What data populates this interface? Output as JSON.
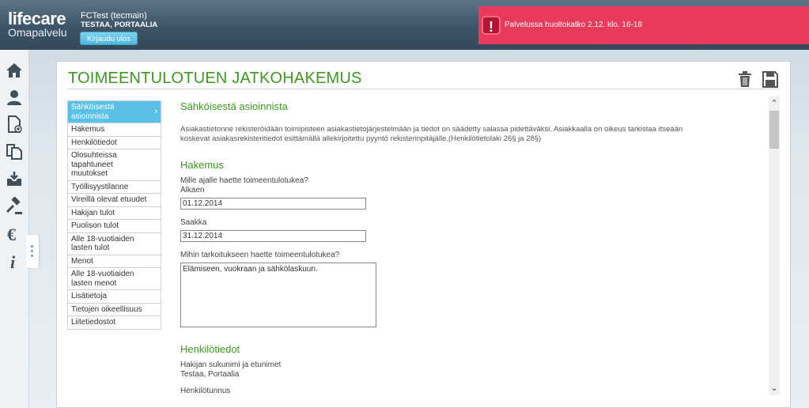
{
  "header": {
    "brand": "lifecare",
    "product": "Omapalvelu",
    "user_name": "FCTest (tecmain)",
    "user_client": "TESTAA, PORTAALIA",
    "logout_label": "Kirjaudu ulos",
    "alert_icon": "!",
    "alert_text": "Palvelussa huoltokatko 2.12. klo. 16-18"
  },
  "sidebar": {
    "icons": [
      "home-icon",
      "person-icon",
      "new-document-icon",
      "documents-icon",
      "inbox-icon",
      "gavel-icon",
      "euro-icon",
      "info-icon"
    ]
  },
  "page": {
    "title": "TOIMEENTULOTUEN JATKOHAKEMUS"
  },
  "nav": {
    "items": [
      {
        "label": "Sähköisestä asioinnista"
      },
      {
        "label": "Hakemus"
      },
      {
        "label": "Henkilötiedot"
      },
      {
        "label": "Olosuhteissa tapahtuneet muutokset"
      },
      {
        "label": "Työllisyystilanne"
      },
      {
        "label": "Vireillä olevat etuudet"
      },
      {
        "label": "Hakijan tulot"
      },
      {
        "label": "Puolison tulot"
      },
      {
        "label": "Alle 18-vuotiaiden lasten tulot"
      },
      {
        "label": "Menot"
      },
      {
        "label": "Alle 18-vuotiaiden lasten menot"
      },
      {
        "label": "Lisätietoja"
      },
      {
        "label": "Tietojen oikeellisuus"
      },
      {
        "label": "Liitetiedostot"
      }
    ]
  },
  "content": {
    "section1_title": "Sähköisestä asioinnista",
    "section1_text": "Asiakastietonne rekisteröidään toimipisteen asiakastietojärjestelmään ja tiedot on säädetty salassa pidettäväksi. Asiakkaalla on oikeus tarkistaa itseään koskevat asiakasrekisteritiedot esittämällä allekirjoitettu pyyntö rekisterinpitäjälle.(Henkilötietolaki 26§ ja 28§)",
    "section2_title": "Hakemus",
    "question_period": "Mille ajalle haette toimeentulotukea?",
    "start_label": "Alkaen",
    "start_value": "01.12.2014",
    "end_label": "Saakka",
    "end_value": "31.12.2014",
    "purpose_label": "Mihin tarkoitukseen haette toimeentulotukea?",
    "purpose_value": "Elämiseen, vuokraan ja sähkölaskuun.",
    "section3_title": "Henkilötiedot",
    "applicant_name_label": "Hakijan sukunimi ja etunimet",
    "applicant_name_value": "Testaa, Portaalia",
    "ssn_label": "Henkilötunnus"
  },
  "colors": {
    "accent_green": "#3a9a1d",
    "nav_active": "#5bc0e6",
    "alert": "#e83a5b",
    "required_marker": "#f5a623"
  }
}
